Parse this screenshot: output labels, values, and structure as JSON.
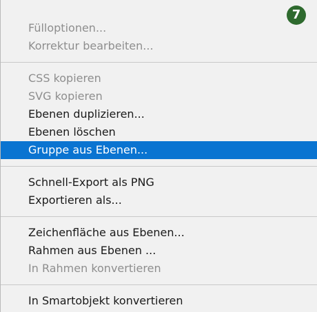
{
  "badge": "7",
  "groups": [
    {
      "items": [
        {
          "label": "Fülloptionen...",
          "disabled": true
        },
        {
          "label": "Korrektur bearbeiten...",
          "disabled": true
        }
      ]
    },
    {
      "items": [
        {
          "label": "CSS kopieren",
          "disabled": true
        },
        {
          "label": "SVG kopieren",
          "disabled": true
        },
        {
          "label": "Ebenen duplizieren...",
          "disabled": false
        },
        {
          "label": "Ebenen löschen",
          "disabled": false
        },
        {
          "label": "Gruppe aus Ebenen...",
          "disabled": false,
          "selected": true
        }
      ]
    },
    {
      "items": [
        {
          "label": "Schnell-Export als PNG",
          "disabled": false
        },
        {
          "label": "Exportieren als...",
          "disabled": false
        }
      ]
    },
    {
      "items": [
        {
          "label": "Zeichenfläche aus Ebenen...",
          "disabled": false
        },
        {
          "label": "Rahmen aus Ebenen ...",
          "disabled": false
        },
        {
          "label": "In Rahmen konvertieren",
          "disabled": true
        }
      ]
    },
    {
      "items": [
        {
          "label": "In Smartobjekt konvertieren",
          "disabled": false
        }
      ]
    }
  ],
  "colors": {
    "menu_background": "#f1f1f1",
    "selected_background": "#0a74d1",
    "disabled_text": "#8e8e8e",
    "badge_background": "#2e6a2e"
  }
}
